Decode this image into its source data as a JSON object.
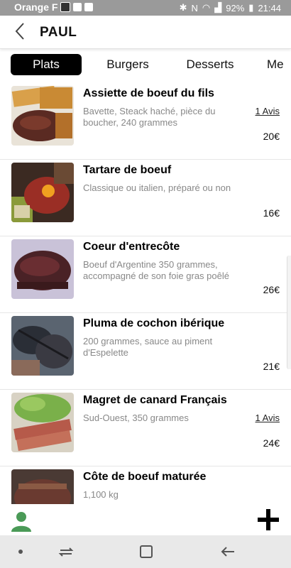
{
  "status": {
    "carrier": "Orange F",
    "battery": "92%",
    "time": "21:44"
  },
  "header": {
    "title": "PAUL"
  },
  "tabs": [
    {
      "label": "Plats",
      "active": true
    },
    {
      "label": "Burgers",
      "active": false
    },
    {
      "label": "Desserts",
      "active": false
    },
    {
      "label": "Me",
      "active": false
    }
  ],
  "items": [
    {
      "name": "Assiette de boeuf du fils",
      "desc": "Bavette, Steack haché, pièce du boucher, 240 grammes",
      "avis": "1 Avis",
      "price": "20€"
    },
    {
      "name": "Tartare de boeuf",
      "desc": "Classique ou italien, préparé ou non",
      "avis": "",
      "price": "16€"
    },
    {
      "name": "Coeur d'entrecôte",
      "desc": "Boeuf d'Argentine 350 grammes, accompagné de son foie gras poêlé",
      "avis": "",
      "price": "26€"
    },
    {
      "name": "Pluma de cochon ibérique",
      "desc": "200 grammes, sauce au piment d'Espelette",
      "avis": "",
      "price": "21€"
    },
    {
      "name": "Magret de canard Français",
      "desc": "Sud-Ouest, 350 grammes",
      "avis": "1 Avis",
      "price": "24€"
    },
    {
      "name": "Côte de boeuf maturée",
      "desc": "1,100 kg",
      "avis": "",
      "price": ""
    }
  ],
  "icons": {
    "back": "chevron-left-icon",
    "user": "user-icon",
    "add": "plus-icon"
  },
  "colors": {
    "accent_green": "#4a9a57",
    "tab_active_bg": "#000000"
  }
}
